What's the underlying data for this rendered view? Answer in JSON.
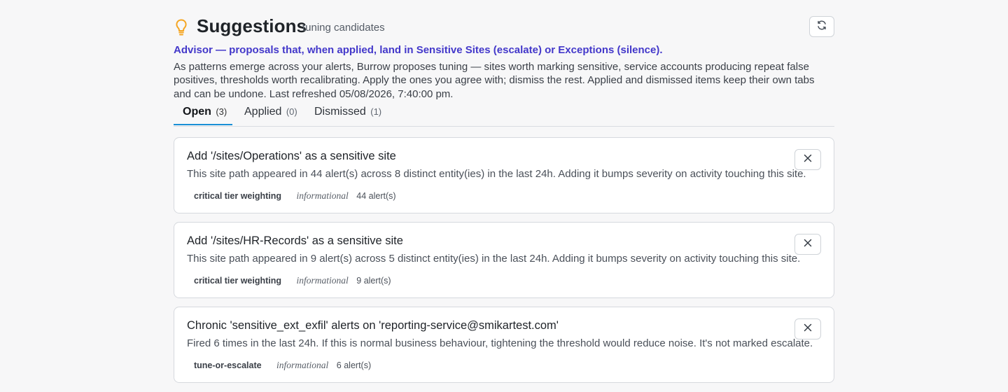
{
  "header": {
    "title": "Suggestions",
    "subtitle": "tuning candidates",
    "icon": "lightbulb-icon",
    "refresh_icon": "refresh-icon"
  },
  "advisor_text": "Advisor — proposals that, when applied, land in Sensitive Sites (escalate) or Exceptions (silence).",
  "description": "As patterns emerge across your alerts, Burrow proposes tuning — sites worth marking sensitive, service accounts producing repeat false positives, thresholds worth recalibrating. Apply the ones you agree with; dismiss the rest. Applied and dismissed items keep their own tabs and can be undone. Last refreshed 05/08/2026, 7:40:00 pm.",
  "tabs": [
    {
      "label": "Open",
      "count": "(3)",
      "active": true
    },
    {
      "label": "Applied",
      "count": "(0)",
      "active": false
    },
    {
      "label": "Dismissed",
      "count": "(1)",
      "active": false
    }
  ],
  "cards": [
    {
      "title": "Add '/sites/Operations' as a sensitive site",
      "body": "This site path appeared in 44 alert(s) across 8 distinct entity(ies) in the last 24h. Adding it bumps severity on activity touching this site.",
      "tag": "critical tier weighting",
      "severity": "informational",
      "alerts": "44 alert(s)"
    },
    {
      "title": "Add '/sites/HR-Records' as a sensitive site",
      "body": "This site path appeared in 9 alert(s) across 5 distinct entity(ies) in the last 24h. Adding it bumps severity on activity touching this site.",
      "tag": "critical tier weighting",
      "severity": "informational",
      "alerts": "9 alert(s)"
    },
    {
      "title": "Chronic 'sensitive_ext_exfil' alerts on 'reporting-service@smikartest.com'",
      "body": "Fired 6 times in the last 24h. If this is normal business behaviour, tightening the threshold would reduce noise. It's not marked escalate.",
      "tag": "tune-or-escalate",
      "severity": "informational",
      "alerts": "6 alert(s)"
    }
  ],
  "colors": {
    "accent": "#4338ca",
    "tab_underline": "#1a8fd6",
    "bulb": "#f5a623"
  }
}
